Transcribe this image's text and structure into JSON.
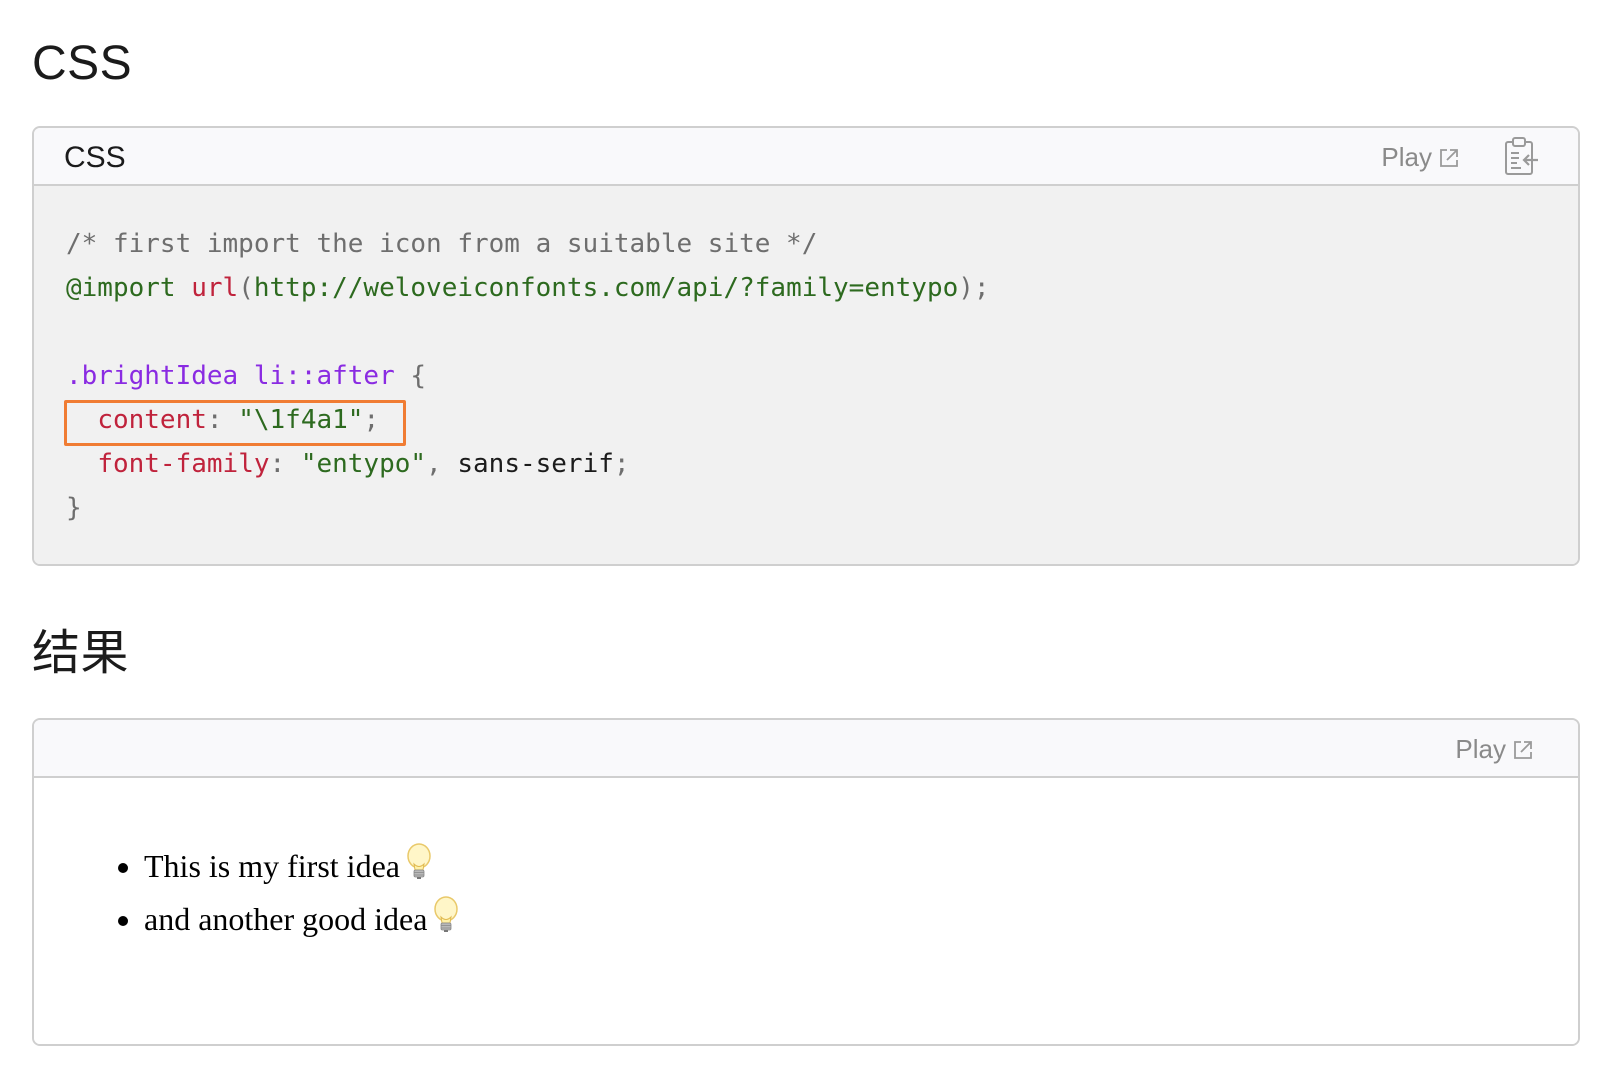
{
  "css_section": {
    "title": "CSS",
    "box_language": "CSS",
    "play_label": "Play",
    "code_lines": [
      [
        {
          "t": "/* first import the icon from a suitable site */",
          "c": "c-comment"
        }
      ],
      [
        {
          "t": "@import",
          "c": "c-atrule"
        },
        {
          "t": " ",
          "c": "c-value"
        },
        {
          "t": "url",
          "c": "c-func"
        },
        {
          "t": "(",
          "c": "c-punct"
        },
        {
          "t": "http://weloveiconfonts.com/api/?family=entypo",
          "c": "c-string"
        },
        {
          "t": ");",
          "c": "c-punct"
        }
      ],
      [],
      [
        {
          "t": ".brightIdea li::after",
          "c": "c-selector"
        },
        {
          "t": " {",
          "c": "c-punct"
        }
      ],
      [
        {
          "t": "  ",
          "c": "c-value"
        },
        {
          "t": "content",
          "c": "c-prop"
        },
        {
          "t": ": ",
          "c": "c-punct"
        },
        {
          "t": "\"\\1f4a1\"",
          "c": "c-string"
        },
        {
          "t": ";",
          "c": "c-punct"
        }
      ],
      [
        {
          "t": "  ",
          "c": "c-value"
        },
        {
          "t": "font-family",
          "c": "c-prop"
        },
        {
          "t": ": ",
          "c": "c-punct"
        },
        {
          "t": "\"entypo\"",
          "c": "c-string"
        },
        {
          "t": ", ",
          "c": "c-punct"
        },
        {
          "t": "sans-serif",
          "c": "c-value"
        },
        {
          "t": ";",
          "c": "c-punct"
        }
      ],
      [
        {
          "t": "}",
          "c": "c-punct"
        }
      ]
    ]
  },
  "result_section": {
    "title": "结果",
    "play_label": "Play",
    "items": [
      "This is my first idea",
      "and another good idea"
    ]
  },
  "colors": {
    "highlight_border": "#f07c33",
    "code_background": "#f1f1f1",
    "header_background": "#f9f9fb"
  }
}
